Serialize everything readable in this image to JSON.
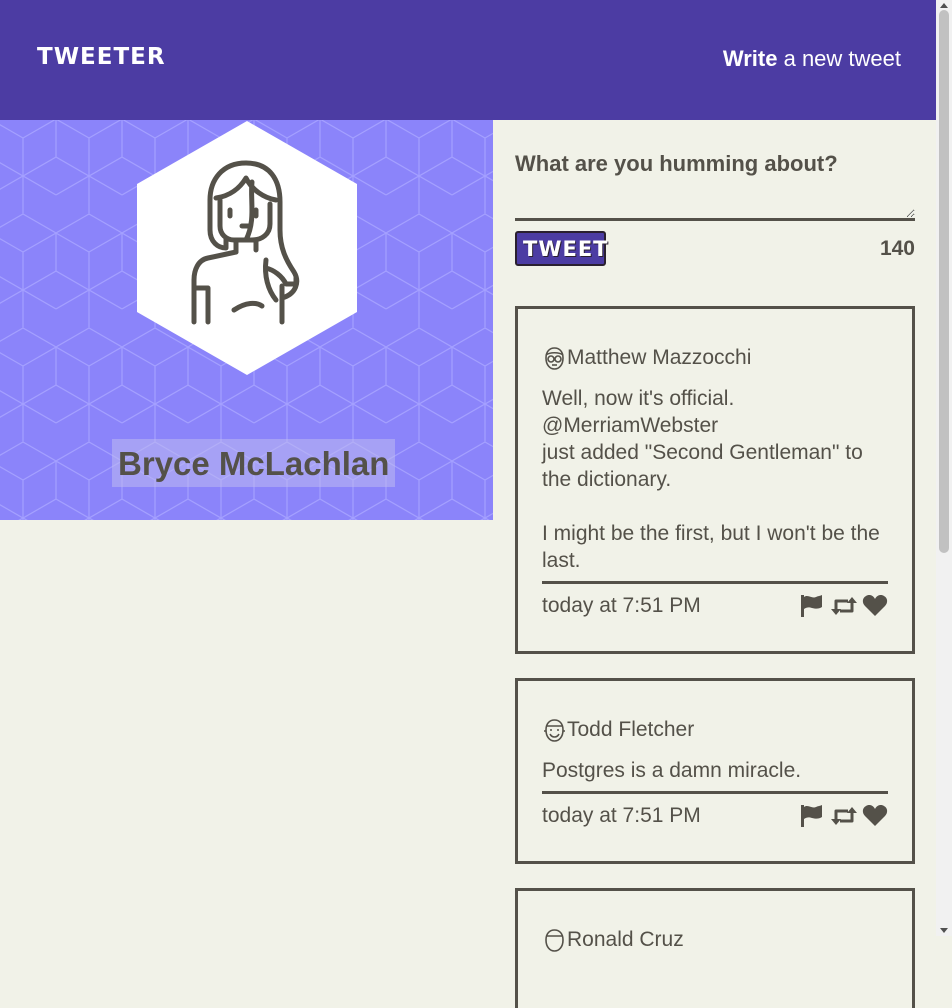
{
  "nav": {
    "brand": "TWEETER",
    "compose_bold": "Write",
    "compose_rest": " a new tweet"
  },
  "profile": {
    "name": "Bryce McLachlan",
    "avatar_icon": "woman-avatar-icon"
  },
  "new_tweet": {
    "label": "What are you humming about?",
    "input_value": "",
    "button_label": "TWEET",
    "counter": "140"
  },
  "tweets": [
    {
      "author": "Matthew Mazzocchi",
      "avatar_icon": "glasses-face-icon",
      "text": "Well, now it's official.\n@MerriamWebster\njust added \"Second Gentleman\" to the dictionary.\n\nI might be the first, but I won't be the last.",
      "time": "today at 7:51 PM"
    },
    {
      "author": "Todd Fletcher",
      "avatar_icon": "smiling-face-icon",
      "text": "Postgres is a damn miracle.",
      "time": "today at 7:51 PM"
    },
    {
      "author": "Ronald Cruz",
      "avatar_icon": "face-icon",
      "text": "",
      "time": ""
    }
  ],
  "colors": {
    "header": "#4c3ca3",
    "profile_bg": "#8b84fa",
    "page_bg": "#f1f2e8",
    "text": "#545149"
  }
}
